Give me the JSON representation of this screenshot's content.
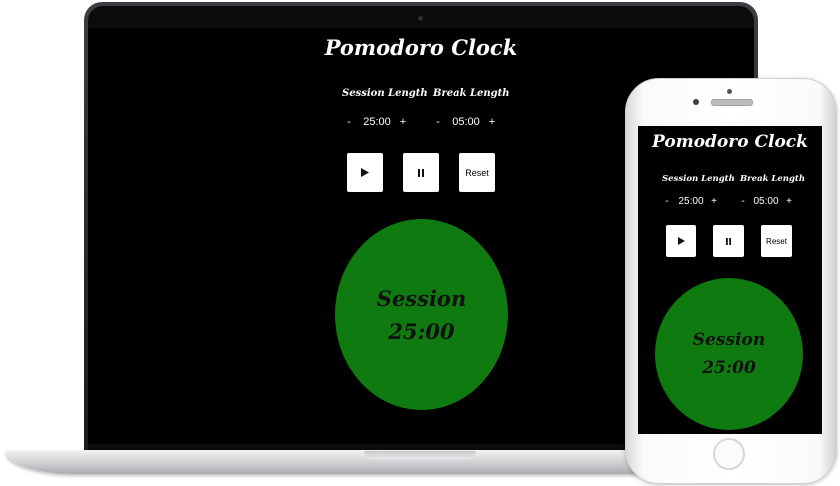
{
  "app": {
    "title": "Pomodoro Clock",
    "session_label": "Session Length",
    "break_label": "Break Length",
    "minus": "-",
    "plus": "+",
    "session_length": "25:00",
    "break_length": "05:00",
    "play_icon": "play-icon",
    "pause_icon": "pause-icon",
    "reset_label": "Reset",
    "timer_label": "Session",
    "timer_value": "25:00",
    "circle_color": "#0f7a0f",
    "background_color": "#000000",
    "button_color": "#ffffff"
  }
}
